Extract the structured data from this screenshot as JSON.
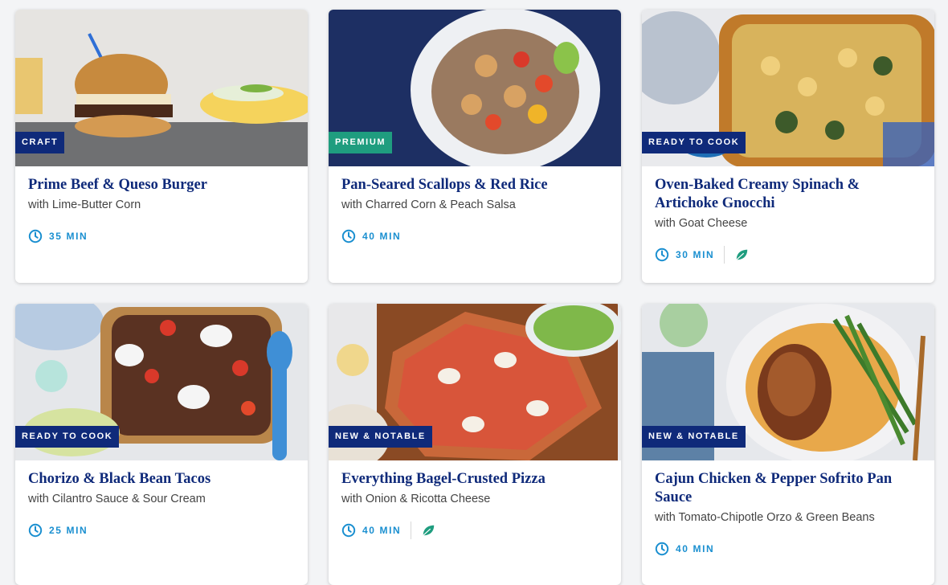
{
  "recipes": [
    {
      "badge": "CRAFT",
      "title": "Prime Beef & Queso Burger",
      "subtitle": "with Lime-Butter Corn",
      "time": "35 MIN"
    },
    {
      "badge": "PREMIUM",
      "title": "Pan-Seared Scallops & Red Rice",
      "subtitle": "with Charred Corn & Peach Salsa",
      "time": "40 MIN"
    },
    {
      "badge": "READY TO COOK",
      "title": "Oven-Baked Creamy Spinach & Artichoke Gnocchi",
      "subtitle": "with Goat Cheese",
      "time": "30 MIN",
      "icon": "leaf-icon"
    },
    {
      "badge": "READY TO COOK",
      "title": "Chorizo & Black Bean Tacos",
      "subtitle": "with Cilantro Sauce & Sour Cream",
      "time": "25 MIN"
    },
    {
      "badge": "NEW & NOTABLE",
      "title": "Everything Bagel-Crusted Pizza",
      "subtitle": "with Onion & Ricotta Cheese",
      "time": "40 MIN",
      "icon": "leaf-icon"
    },
    {
      "badge": "NEW & NOTABLE",
      "title": "Cajun Chicken & Pepper Sofrito Pan Sauce",
      "subtitle": "with Tomato-Chipotle Orzo & Green Beans",
      "time": "40 MIN"
    }
  ],
  "colors": {
    "title": "#0f2a7a",
    "time": "#1a8fd0",
    "badge_navy": "#0f2a7a",
    "badge_green": "#1f9d7f",
    "leaf": "#1f9d7f"
  }
}
